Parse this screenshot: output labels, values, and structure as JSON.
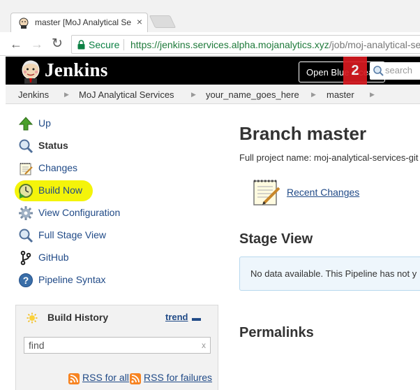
{
  "browser": {
    "tab_title": "master [MoJ Analytical Se",
    "tab_close": "×",
    "secure_label": "Secure",
    "url_host": "https://jenkins.services.alpha.mojanalytics.xyz",
    "url_path": "/job/moj-analytical-ser"
  },
  "header": {
    "logo_text": "Jenkins",
    "open_blue_ocean": "Open Blue Ocean",
    "notification_count": "2",
    "search_placeholder": "search"
  },
  "breadcrumbs": [
    "Jenkins",
    "MoJ Analytical Services",
    "your_name_goes_here",
    "master"
  ],
  "sidebar": {
    "tasks": [
      {
        "label": "Up",
        "icon": "up-arrow-icon"
      },
      {
        "label": "Status",
        "icon": "magnifier-icon"
      },
      {
        "label": "Changes",
        "icon": "notepad-icon"
      },
      {
        "label": "Build Now",
        "icon": "build-clock-icon"
      },
      {
        "label": "View Configuration",
        "icon": "gear-icon"
      },
      {
        "label": "Full Stage View",
        "icon": "magnifier-icon"
      },
      {
        "label": "GitHub",
        "icon": "github-branch-icon"
      },
      {
        "label": "Pipeline Syntax",
        "icon": "help-icon"
      }
    ],
    "highlight_color": "#f4f40a"
  },
  "build_history": {
    "title": "Build History",
    "trend_label": "trend",
    "find_value": "find",
    "clear_label": "x",
    "rss_all": "RSS for all",
    "rss_failures": "RSS for failures"
  },
  "main": {
    "title": "Branch master",
    "full_project_name": "Full project name: moj-analytical-services-git",
    "recent_changes": "Recent Changes",
    "stage_view_heading": "Stage View",
    "no_data_text": "No data available. This Pipeline has not y",
    "permalinks_heading": "Permalinks"
  },
  "colors": {
    "link": "#204a87",
    "header_bg": "#000000",
    "badge": "#d71920",
    "secure_green": "#0b8043"
  }
}
